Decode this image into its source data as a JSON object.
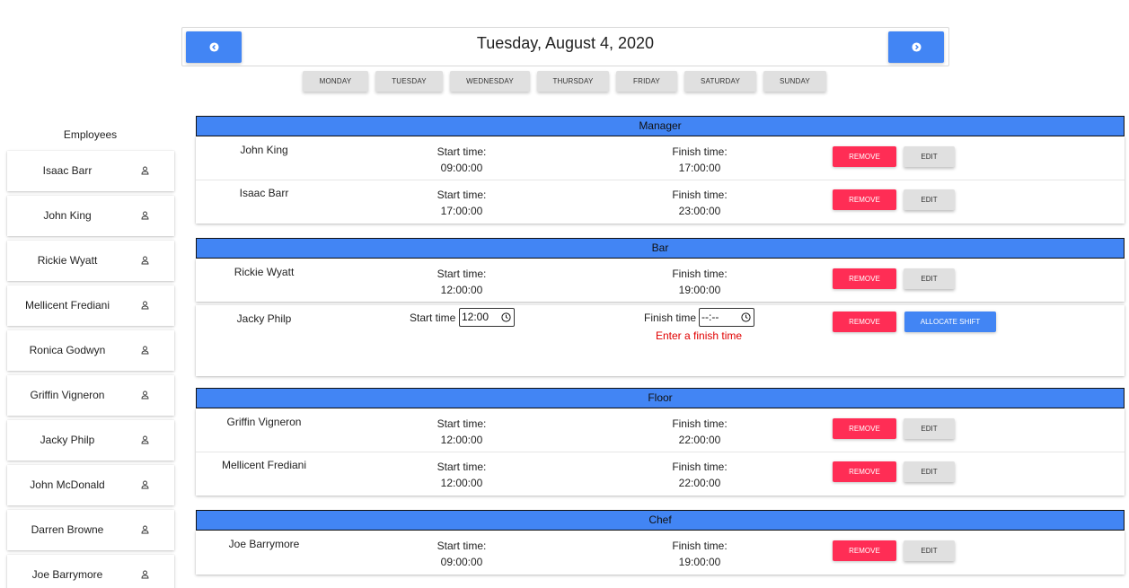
{
  "header": {
    "date": "Tuesday, August 4, 2020",
    "prev_icon": "chevron-left-circle-icon",
    "next_icon": "chevron-right-circle-icon"
  },
  "days": [
    "MONDAY",
    "TUESDAY",
    "WEDNESDAY",
    "THURSDAY",
    "FRIDAY",
    "SATURDAY",
    "SUNDAY"
  ],
  "employees": {
    "heading": "Employees",
    "icon": "person-icon",
    "items": [
      "Isaac Barr",
      "John King",
      "Rickie Wyatt",
      "Mellicent Frediani",
      "Ronica Godwyn",
      "Griffin Vigneron",
      "Jacky Philp",
      "John McDonald",
      "Darren Browne",
      "Joe Barrymore"
    ]
  },
  "labels": {
    "start_time": "Start time:",
    "finish_time": "Finish time:",
    "remove": "REMOVE",
    "edit": "EDIT",
    "allocate": "ALLOCATE SHIFT",
    "start_time_input": "Start time",
    "finish_time_input": "Finish time"
  },
  "departments": [
    {
      "name": "Manager",
      "shifts": [
        {
          "employee": "John King",
          "start": "09:00:00",
          "finish": "17:00:00"
        },
        {
          "employee": "Isaac Barr",
          "start": "17:00:00",
          "finish": "23:00:00"
        }
      ]
    },
    {
      "name": "Bar",
      "shifts": [
        {
          "employee": "Rickie Wyatt",
          "start": "12:00:00",
          "finish": "19:00:00"
        }
      ],
      "pending": {
        "employee": "Jacky Philp",
        "start_value": "12:00",
        "finish_value": "--:--",
        "error": "Enter a finish time"
      }
    },
    {
      "name": "Floor",
      "shifts": [
        {
          "employee": "Griffin Vigneron",
          "start": "12:00:00",
          "finish": "22:00:00"
        },
        {
          "employee": "Mellicent Frediani",
          "start": "12:00:00",
          "finish": "22:00:00"
        }
      ]
    },
    {
      "name": "Chef",
      "shifts": [
        {
          "employee": "Joe Barrymore",
          "start": "09:00:00",
          "finish": "19:00:00"
        }
      ]
    }
  ],
  "colors": {
    "primary": "#4285f4",
    "danger": "#ff2d55",
    "neutral": "#e0e0e0",
    "error": "#e00000"
  }
}
